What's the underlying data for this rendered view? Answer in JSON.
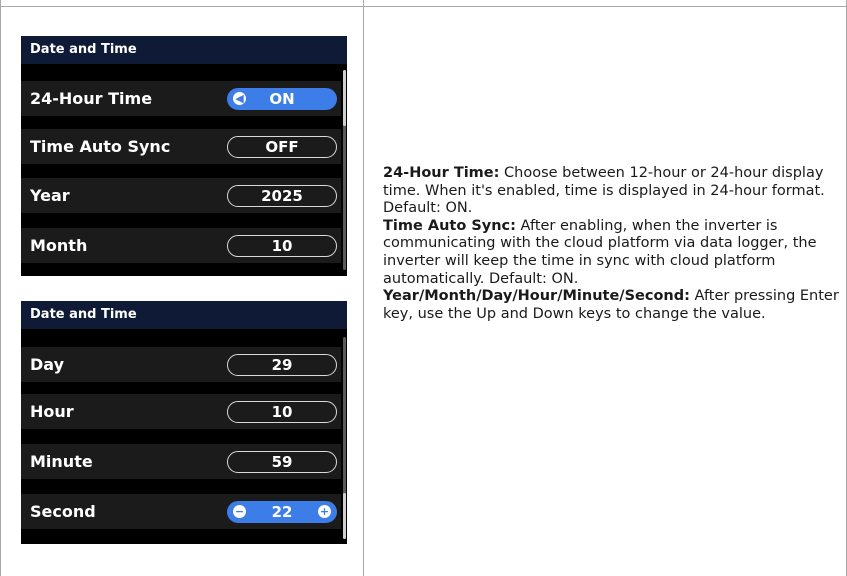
{
  "panel1": {
    "title": "Date and Time",
    "rows": [
      {
        "label": "24-Hour Time",
        "value": "ON",
        "active": true
      },
      {
        "label": "Time Auto Sync",
        "value": "OFF",
        "active": false
      },
      {
        "label": "Year",
        "value": "2025",
        "active": false
      },
      {
        "label": "Month",
        "value": "10",
        "active": false
      }
    ]
  },
  "panel2": {
    "title": "Date and Time",
    "rows": [
      {
        "label": "Day",
        "value": "29",
        "active": false
      },
      {
        "label": "Hour",
        "value": "10",
        "active": false
      },
      {
        "label": "Minute",
        "value": "59",
        "active": false
      },
      {
        "label": "Second",
        "value": "22",
        "active": true
      }
    ]
  },
  "description": [
    {
      "term": "24-Hour Time:",
      "text": " Choose between 12-hour or 24-hour display time. When it's enabled, time is displayed in 24-hour format. Default: ON."
    },
    {
      "term": "Time Auto Sync:",
      "text": " After enabling, when the inverter is communicating with the cloud platform via data logger, the inverter will keep the time in sync with cloud platform automatically. Default: ON."
    },
    {
      "term": "Year/Month/Day/Hour/Minute/Second:",
      "text": " After pressing Enter key, use the Up and Down keys to change the value."
    }
  ],
  "icons": {
    "left_arrow": "left-triangle-icon",
    "minus": "minus-icon",
    "plus": "plus-icon"
  },
  "colors": {
    "header_bg": "#0f1a36",
    "row_bg": "#1b1b1b",
    "active": "#3d7de8"
  }
}
